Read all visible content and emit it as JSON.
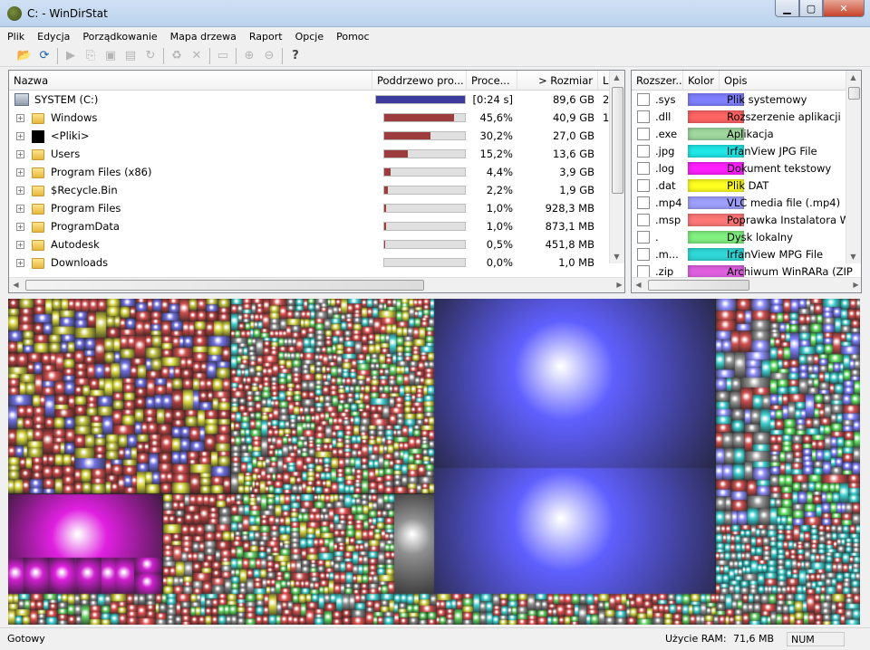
{
  "window": {
    "title": "C: - WinDirStat",
    "min_glyph": "▁",
    "max_glyph": "▢",
    "close_glyph": "✕"
  },
  "menu": [
    "Plik",
    "Edycja",
    "Porządkowanie",
    "Mapa drzewa",
    "Raport",
    "Opcje",
    "Pomoc"
  ],
  "toolbar": {
    "icons": [
      "open-icon",
      "refresh-icon",
      "play-icon",
      "copy-icon",
      "explorer-icon",
      "console-icon",
      "refresh-selected-icon",
      "recycle-icon",
      "delete-icon",
      "new-folder-icon",
      "zoom-in-icon",
      "zoom-out-icon",
      "help-icon"
    ],
    "glyphs": [
      "📂",
      "⟳",
      "▶",
      "⎘",
      "▣",
      "▤",
      "↻",
      "♻",
      "✕",
      "▭",
      "⊕",
      "⊖",
      "?"
    ]
  },
  "tree": {
    "columns": [
      "Nazwa",
      "Poddrzewo pro...",
      "Proce...",
      "> Rozmiar",
      "L"
    ],
    "root": {
      "name": "SYSTEM (C:)",
      "time": "[0:24 s]",
      "size": "89,6 GB",
      "extra": "2",
      "bar": 1.0
    },
    "rows": [
      {
        "name": "Windows",
        "percent": "45,6%",
        "size": "40,9 GB",
        "extra": "1",
        "bar": 0.456,
        "icon": "folder"
      },
      {
        "name": "<Pliki>",
        "percent": "30,2%",
        "size": "27,0 GB",
        "extra": "",
        "bar": 0.302,
        "icon": "black"
      },
      {
        "name": "Users",
        "percent": "15,2%",
        "size": "13,6 GB",
        "extra": "",
        "bar": 0.152,
        "icon": "folder"
      },
      {
        "name": "Program Files (x86)",
        "percent": "4,4%",
        "size": "3,9 GB",
        "extra": "",
        "bar": 0.044,
        "icon": "folder"
      },
      {
        "name": "$Recycle.Bin",
        "percent": "2,2%",
        "size": "1,9 GB",
        "extra": "",
        "bar": 0.022,
        "icon": "folder"
      },
      {
        "name": "Program Files",
        "percent": "1,0%",
        "size": "928,3 MB",
        "extra": "",
        "bar": 0.01,
        "icon": "folder"
      },
      {
        "name": "ProgramData",
        "percent": "1,0%",
        "size": "873,1 MB",
        "extra": "",
        "bar": 0.01,
        "icon": "folder"
      },
      {
        "name": "Autodesk",
        "percent": "0,5%",
        "size": "451,8 MB",
        "extra": "",
        "bar": 0.005,
        "icon": "folder"
      },
      {
        "name": "Downloads",
        "percent": "0,0%",
        "size": "1,0 MB",
        "extra": "",
        "bar": 0.0,
        "icon": "folder"
      }
    ],
    "root_bar_color": "#3c3c9c",
    "sub_bar_color": "#9c3c3c"
  },
  "ext": {
    "columns": [
      "Rozszer...",
      "Kolor",
      "Opis"
    ],
    "rows": [
      {
        "ext": ".sys",
        "color": "#8080ff",
        "desc": "Plik systemowy"
      },
      {
        "ext": ".dll",
        "color": "#ff6464",
        "desc": "Rozszerzenie aplikacji"
      },
      {
        "ext": ".exe",
        "color": "#a0d8a0",
        "desc": "Aplikacja"
      },
      {
        "ext": ".jpg",
        "color": "#20e8e8",
        "desc": "IrfanView JPG File"
      },
      {
        "ext": ".log",
        "color": "#ff20ff",
        "desc": "Dokument tekstowy"
      },
      {
        "ext": ".dat",
        "color": "#ffff20",
        "desc": "Plik DAT"
      },
      {
        "ext": ".mp4",
        "color": "#a0a0ff",
        "desc": "VLC media file (.mp4)"
      },
      {
        "ext": ".msp",
        "color": "#ff7878",
        "desc": "Poprawka Instalatora Win"
      },
      {
        "ext": ".",
        "color": "#80f080",
        "desc": "Dysk lokalny"
      },
      {
        "ext": ".m...",
        "color": "#30d8d8",
        "desc": "IrfanView MPG File"
      },
      {
        "ext": ".zip",
        "color": "#e060e0",
        "desc": "Archiwum WinRARa (ZIP"
      }
    ]
  },
  "status": {
    "left": "Gotowy",
    "ram_label": "Użycie RAM:",
    "ram_value": "71,6 MB",
    "num": "NUM"
  }
}
